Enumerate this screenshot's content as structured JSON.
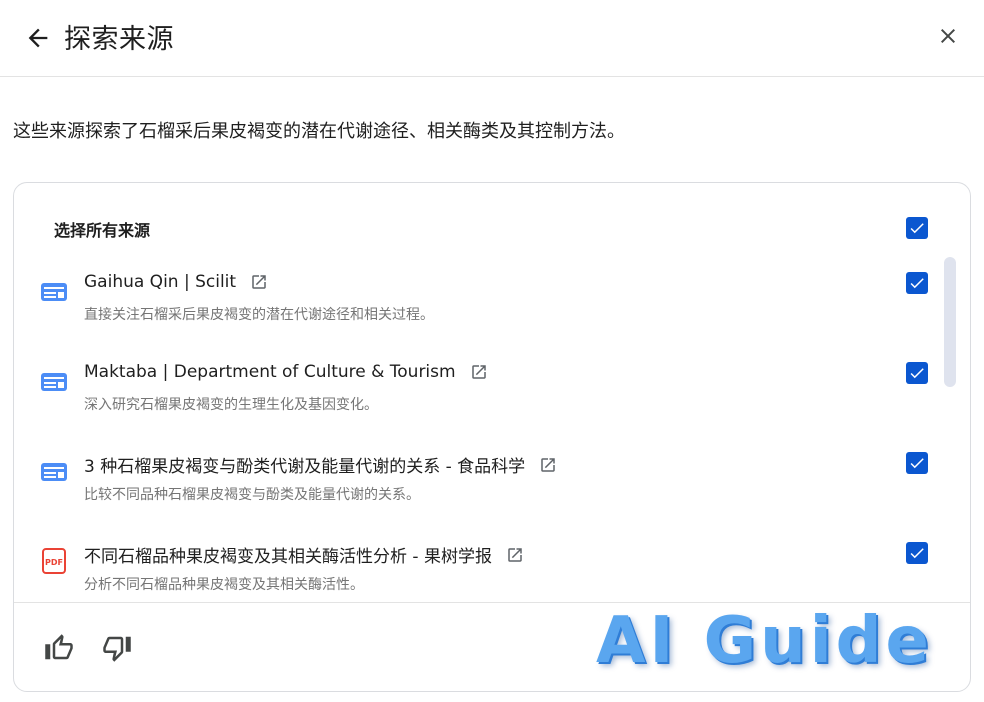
{
  "header": {
    "title": "探索来源"
  },
  "description": "这些来源探索了石榴采后果皮褐变的潜在代谢途径、相关酶类及其控制方法。",
  "select_all": {
    "label": "选择所有来源",
    "checked": true
  },
  "sources": [
    {
      "title": "Gaihua Qin | Scilit",
      "subtitle": "直接关注石榴采后果皮褐变的潜在代谢途径和相关过程。",
      "icon": "web-page-icon",
      "checked": true
    },
    {
      "title": "Maktaba | Department of Culture & Tourism",
      "subtitle": "深入研究石榴果皮褐变的生理生化及基因变化。",
      "icon": "web-page-icon",
      "checked": true
    },
    {
      "title": "3 种石榴果皮褐变与酚类代谢及能量代谢的关系 - 食品科学",
      "subtitle": "比较不同品种石榴果皮褐变与酚类及能量代谢的关系。",
      "icon": "web-page-icon",
      "checked": true
    },
    {
      "title": "不同石榴品种果皮褐变及其相关酶活性分析 - 果树学报",
      "subtitle": "分析不同石榴品种果皮褐变及其相关酶活性。",
      "icon": "pdf-icon",
      "checked": true
    }
  ],
  "watermark": "AI Guide",
  "colors": {
    "accent": "#0b57d0",
    "web_icon": "#4c8df6",
    "pdf_icon": "#ea4335",
    "subtext": "#757575"
  }
}
